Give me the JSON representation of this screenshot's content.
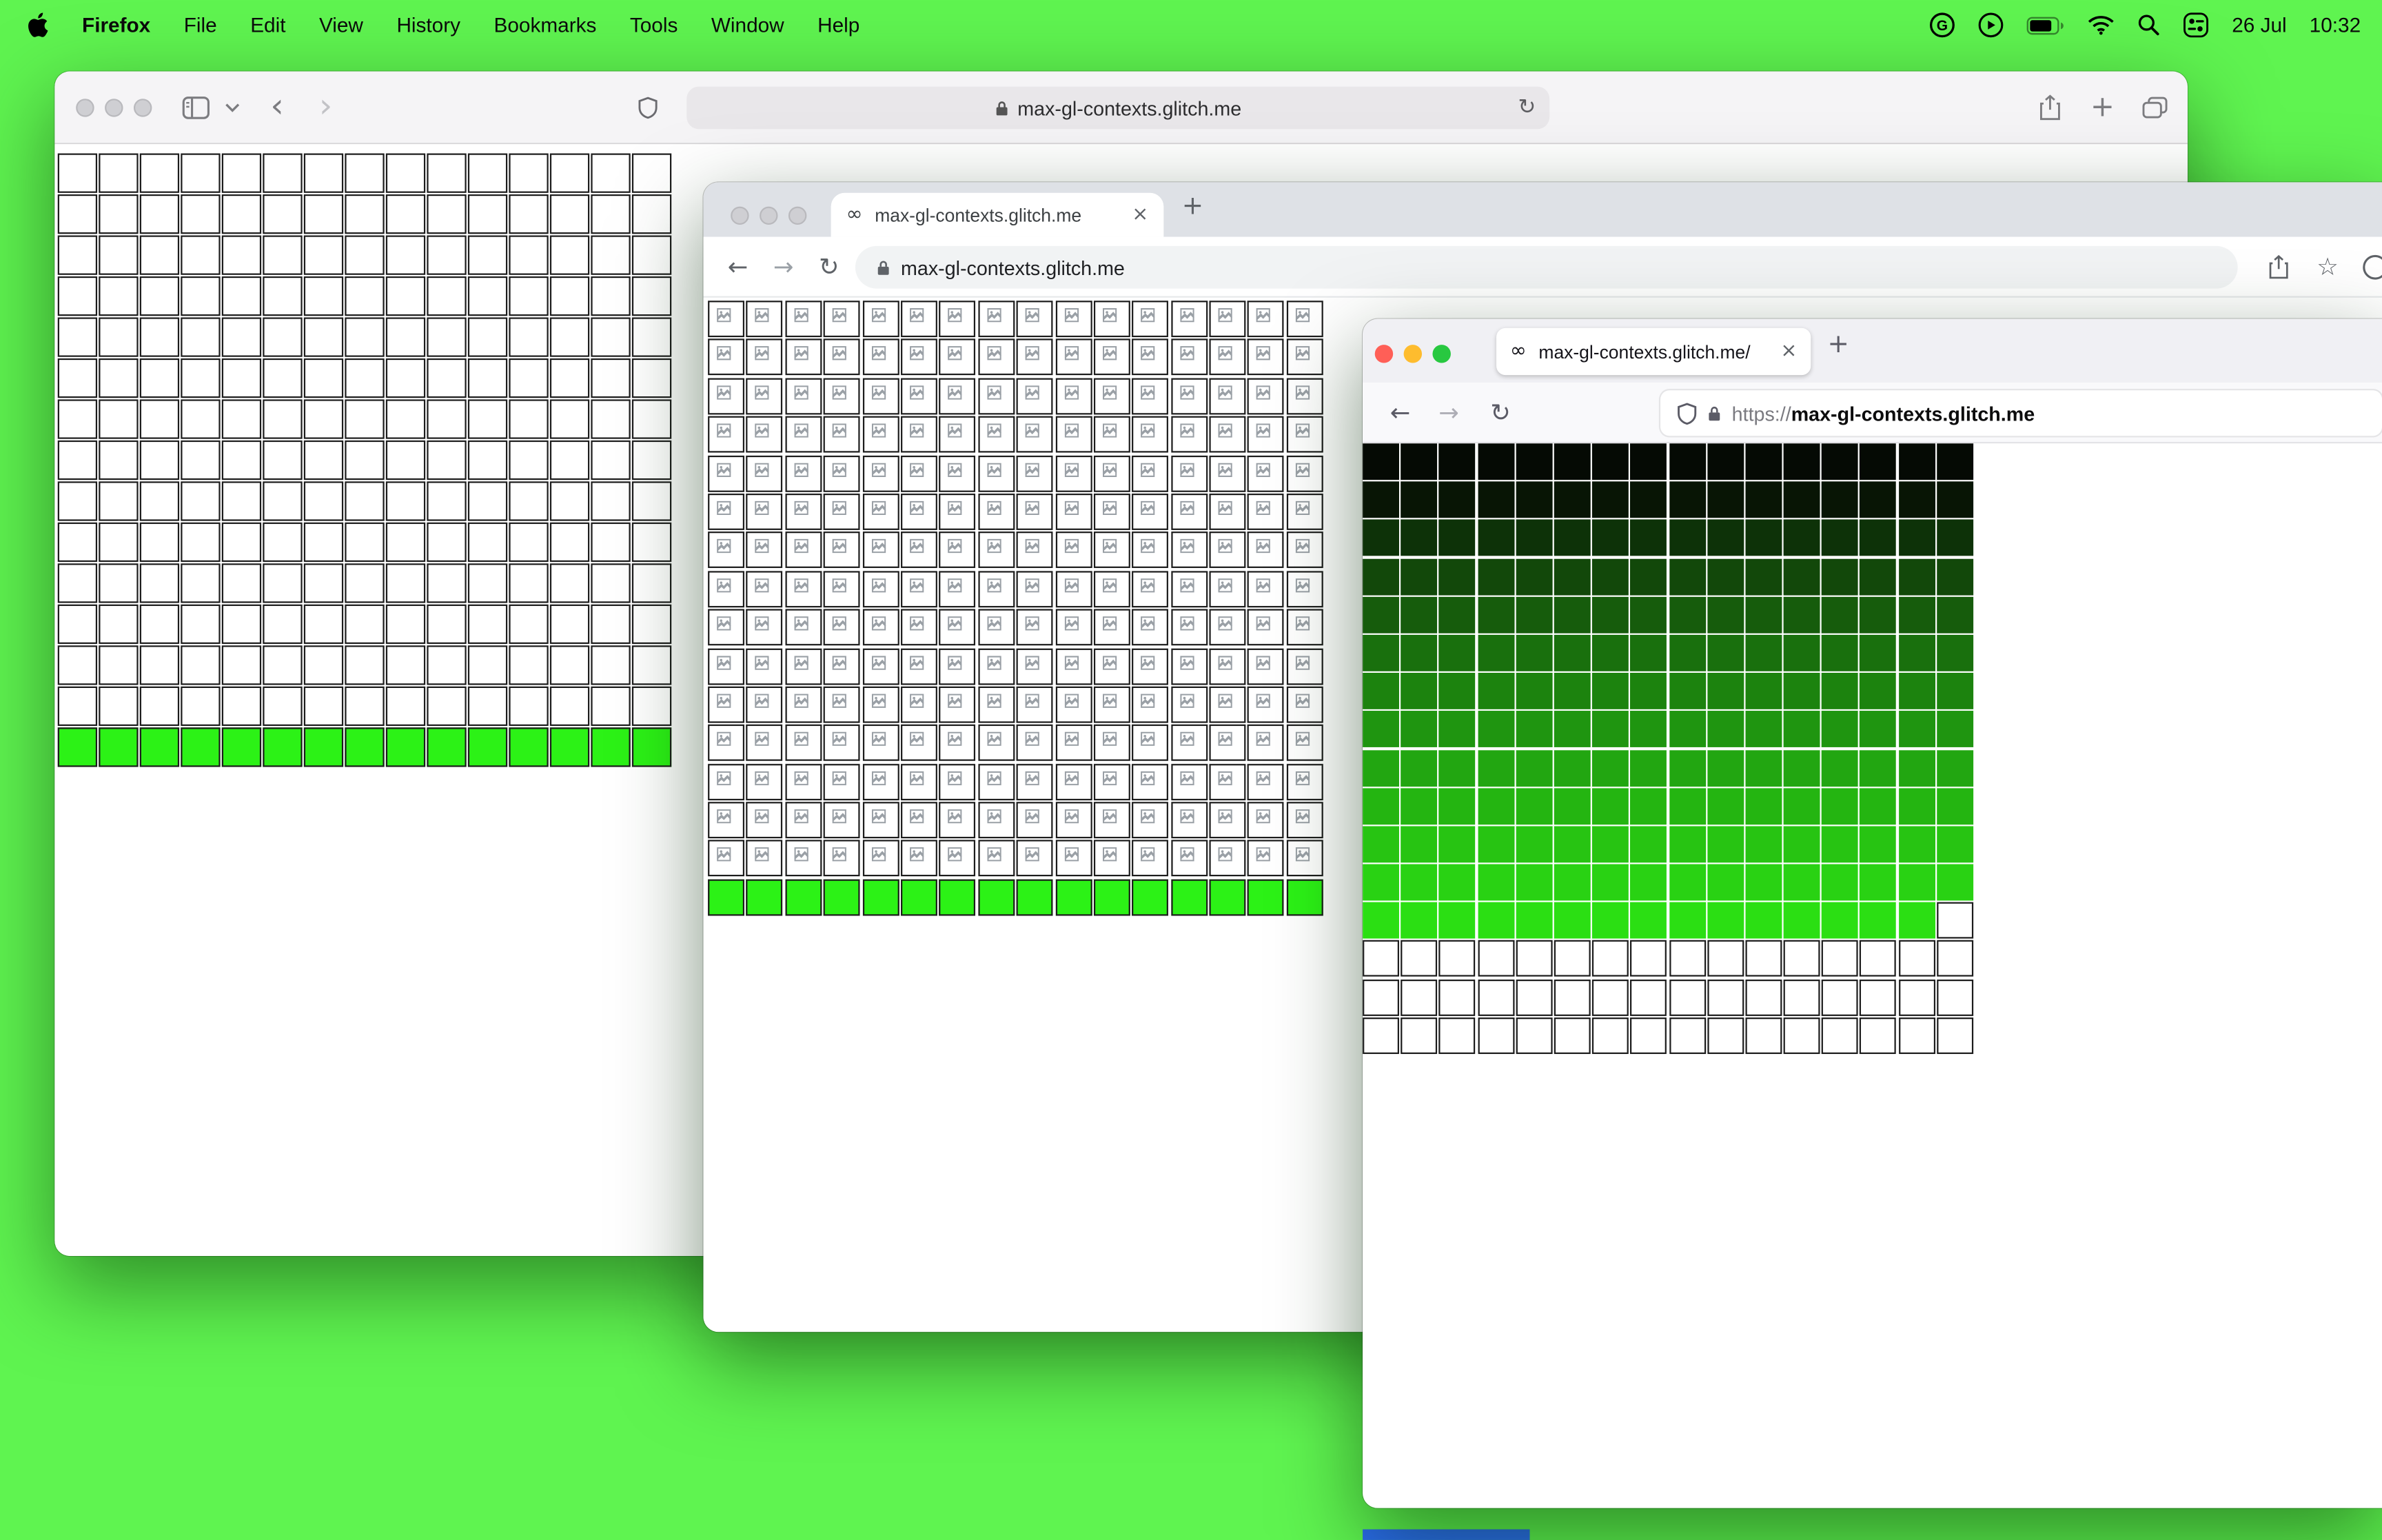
{
  "colors": {
    "desktop-bg": "#5ff450",
    "lime": "#2cf216",
    "safari-toolbar": "#f5f4f6",
    "safari-field": "#e9e7ea",
    "chrome-tabbar": "#dee1e6",
    "chrome-pill": "#f1f3f4",
    "firefox-tabbar": "#f0f0f4",
    "firefox-toolbar": "#f9f9fb",
    "traffic-red": "#ff5f57",
    "traffic-yellow": "#febc2e",
    "traffic-green": "#28c840",
    "inactive-light": "#cfcfd3",
    "blue-sliver": "#2b6bf0",
    "cell-border": "#1c1c1c"
  },
  "icons": {
    "back_chevron": "‹",
    "forward_chevron": "›",
    "back_arrow": "←",
    "forward_arrow": "→",
    "reload": "↻",
    "close": "×",
    "new_tab": "+",
    "star": "☆",
    "infinity": "∞"
  },
  "menu_bar": {
    "app_name": "Firefox",
    "menus": [
      "File",
      "Edit",
      "View",
      "History",
      "Bookmarks",
      "Tools",
      "Window",
      "Help"
    ],
    "date": "26 Jul",
    "time": "10:32"
  },
  "safari_window": {
    "url": "max-gl-contexts.glitch.me",
    "grid": {
      "cols": 15,
      "rows": 15,
      "green_bottom_rows": 1
    }
  },
  "chrome_window": {
    "tab_title": "max-gl-contexts.glitch.me",
    "url": "max-gl-contexts.glitch.me",
    "grid": {
      "cols": 16,
      "rows": 16,
      "green_bottom_rows": 1,
      "broken_icon_cells": true
    }
  },
  "firefox_window": {
    "tab_title": "max-gl-contexts.glitch.me/",
    "url_scheme": "https://",
    "url_host": "max-gl-contexts.glitch.me",
    "grid": {
      "cols": 16,
      "row_colors": [
        "#050a04",
        "#081505",
        "#0d3208",
        "#12480a",
        "#165c0c",
        "#19700d",
        "#1c830e",
        "#1f9510",
        "#22a611",
        "#24b511",
        "#27c412",
        "#29d213",
        "#2bdf13"
      ],
      "last_colored_row_trailing_white_cells": 1,
      "trailing_white_rows": 3
    }
  }
}
